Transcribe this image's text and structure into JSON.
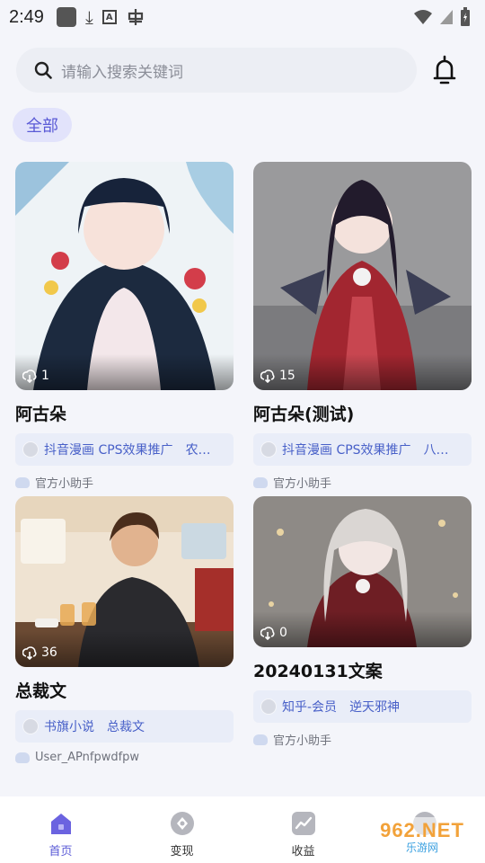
{
  "status_bar": {
    "time": "2:49",
    "icons": [
      "app-square-icon",
      "download-icon",
      "a-badge-icon",
      "bug-icon",
      "wifi-icon",
      "signal-icon",
      "battery-icon"
    ]
  },
  "search": {
    "placeholder": "请输入搜索关键词"
  },
  "filter": {
    "chip_label": "全部"
  },
  "cards": [
    {
      "title": "阿古朵",
      "downloads": "1",
      "tags": [
        "抖音漫画 CPS效果推广",
        "农…"
      ],
      "author": "官方小助手"
    },
    {
      "title": "阿古朵(测试)",
      "downloads": "15",
      "tags": [
        "抖音漫画 CPS效果推广",
        "八…"
      ],
      "author": "官方小助手"
    },
    {
      "title": "总裁文",
      "downloads": "36",
      "tags": [
        "书旗小说",
        "总裁文"
      ],
      "author": "User_APnfpwdfpw"
    },
    {
      "title": "20240131文案",
      "downloads": "0",
      "tags": [
        "知乎-会员",
        "逆天邪神"
      ],
      "author": "官方小助手"
    }
  ],
  "bottom_nav": {
    "items": [
      {
        "label": "首页",
        "icon": "home-icon",
        "active": true
      },
      {
        "label": "变现",
        "icon": "compass-icon",
        "active": false
      },
      {
        "label": "收益",
        "icon": "chart-icon",
        "active": false
      },
      {
        "label": "",
        "icon": "profile-icon",
        "active": false
      }
    ]
  },
  "watermark": {
    "top": "962.NET",
    "bottom": "乐游网"
  },
  "colors": {
    "accent": "#5a5ad6",
    "tag_text": "#4860c8",
    "background": "#f4f5fa"
  }
}
